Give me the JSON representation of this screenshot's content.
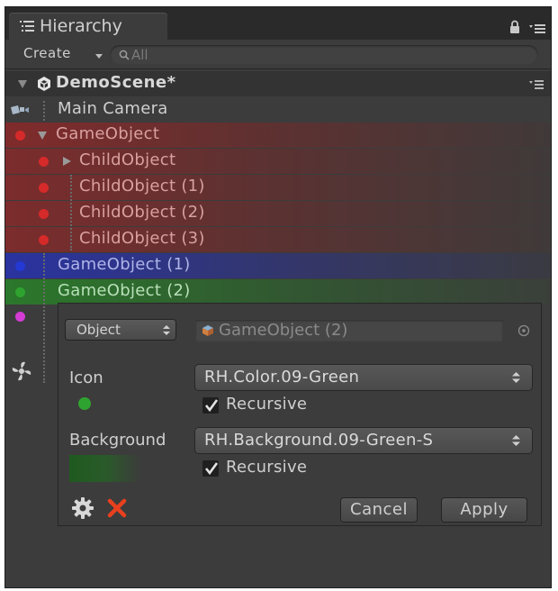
{
  "window": {
    "tab_title": "Hierarchy"
  },
  "toolbar": {
    "create_label": "Create",
    "search_placeholder": "All"
  },
  "scene": {
    "name": "DemoScene*"
  },
  "tree": {
    "items": [
      {
        "label": "Main Camera"
      },
      {
        "label": "GameObject"
      },
      {
        "label": "ChildObject"
      },
      {
        "label": "ChildObject (1)"
      },
      {
        "label": "ChildObject (2)"
      },
      {
        "label": "ChildObject (3)"
      },
      {
        "label": "GameObject (1)"
      },
      {
        "label": "GameObject (2)"
      }
    ]
  },
  "panel": {
    "object_type": "Object",
    "object_value": "GameObject (2)",
    "icon_label": "Icon",
    "icon_value": "RH.Color.09-Green",
    "icon_recursive_label": "Recursive",
    "background_label": "Background",
    "background_value": "RH.Background.09-Green-S",
    "background_recursive_label": "Recursive",
    "cancel_label": "Cancel",
    "apply_label": "Apply"
  },
  "colors": {
    "red": "#d62a2a",
    "blue": "#2438d4",
    "green": "#2fa32f",
    "magenta": "#d43cd4",
    "background": "#3c3c3c"
  },
  "icons": [
    "list-icon",
    "lock-icon",
    "menu-icon",
    "search-icon",
    "unity-icon",
    "camera-icon",
    "fold-arrow-icon",
    "cube-icon",
    "target-icon",
    "gear-icon",
    "delete-icon",
    "fan-icon"
  ]
}
